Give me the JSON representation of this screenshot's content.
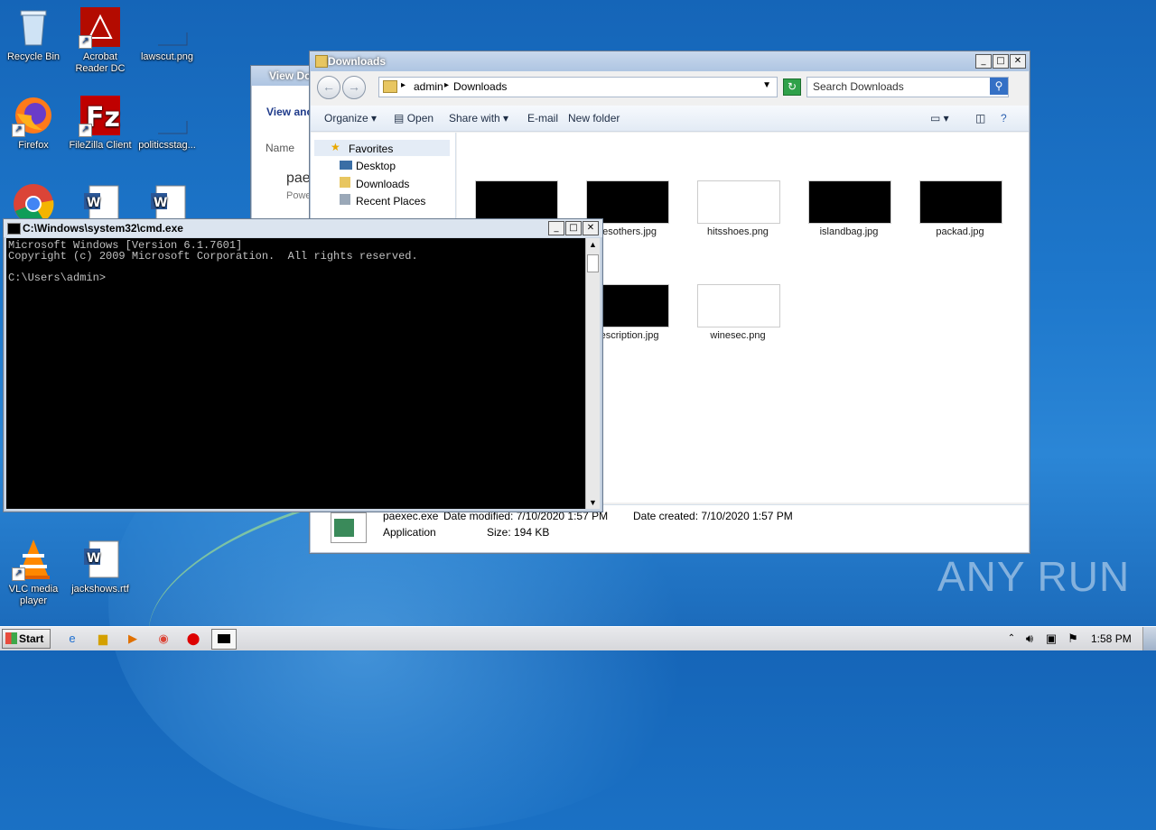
{
  "desktop": {
    "icons": [
      {
        "label": "Recycle Bin"
      },
      {
        "label": "Acrobat Reader DC"
      },
      {
        "label": "lawscut.png"
      },
      {
        "label": "Firefox"
      },
      {
        "label": "FileZilla Client"
      },
      {
        "label": "politicsstag..."
      },
      {
        "label": "VLC media player"
      },
      {
        "label": "jackshows.rtf"
      }
    ],
    "watermark": "ANY RUN"
  },
  "viewer": {
    "title": "View Do",
    "heading": "View anc",
    "col_name": "Name",
    "item1": "pae",
    "item2": "Powe"
  },
  "explorer": {
    "title": "Downloads",
    "breadcrumb": [
      "admin",
      "Downloads"
    ],
    "search_placeholder": "Search Downloads",
    "toolbar": {
      "organize": "Organize",
      "open": "Open",
      "share": "Share with",
      "email": "E-mail",
      "new_folder": "New folder"
    },
    "nav": {
      "favorites": "Favorites",
      "desktop": "Desktop",
      "downloads": "Downloads",
      "recent": "Recent Places"
    },
    "files": [
      {
        "name": "desothers.jpg"
      },
      {
        "name": "hitsshoes.png"
      },
      {
        "name": "islandbag.jpg"
      },
      {
        "name": "packad.jpg"
      },
      {
        "name": "description.jpg"
      },
      {
        "name": "winesec.png"
      }
    ],
    "details": {
      "filename": "paexec.exe",
      "modified": "Date modified: 7/10/2020 1:57 PM",
      "created": "Date created: 7/10/2020 1:57 PM",
      "type": "Application",
      "size": "Size: 194 KB"
    }
  },
  "cmd": {
    "title": "C:\\Windows\\system32\\cmd.exe",
    "lines": "Microsoft Windows [Version 6.1.7601]\nCopyright (c) 2009 Microsoft Corporation.  All rights reserved.\n\nC:\\Users\\admin>"
  },
  "taskbar": {
    "start": "Start",
    "clock": "1:58 PM"
  }
}
